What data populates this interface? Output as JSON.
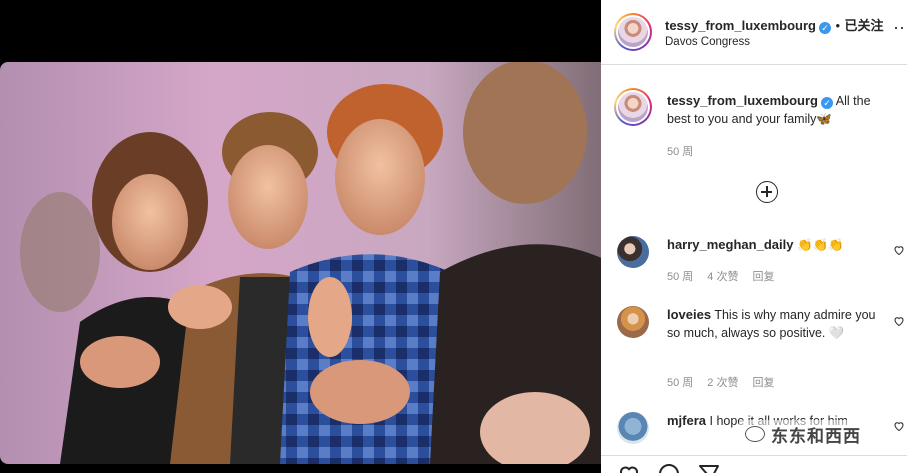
{
  "post_header": {
    "username": "tessy_from_luxembourg",
    "dot": "•",
    "follow_label": "已关注",
    "location": "Davos Congress"
  },
  "caption": {
    "username": "tessy_from_luxembourg",
    "text": "All the best to you and your family🦋",
    "time": "50 周"
  },
  "load_more_icon": "plus-circle-icon",
  "comments": [
    {
      "username": "harry_meghan_daily",
      "text": "👏👏👏",
      "time": "50 周",
      "likes": "4 次赞",
      "reply": "回复"
    },
    {
      "username": "loveies",
      "text": "This is why many admire you so much, always so positive. 🤍",
      "time": "50 周",
      "likes": "2 次赞",
      "reply": "回复"
    },
    {
      "username": "mjfera",
      "text": "I hope it all works for him"
    }
  ],
  "watermark": "东东和西西",
  "photo": {
    "description_icon": "group-clapping-photo"
  },
  "colors": {
    "link_blue": "#3897f0",
    "meta_gray": "#8e8e8e",
    "text": "#262626",
    "border": "#dbdbdb"
  }
}
